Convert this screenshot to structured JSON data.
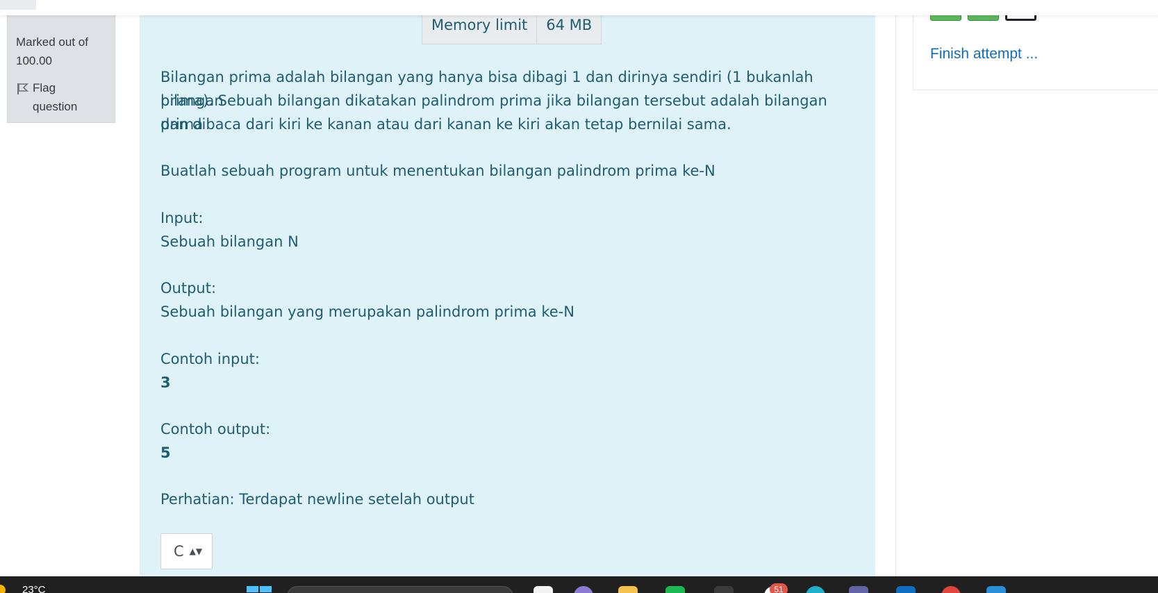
{
  "info": {
    "grade_label": "Marked out of",
    "grade_value": "100.00",
    "flag_label": "Flag",
    "flag_label_2": "question"
  },
  "limits": {
    "memory_label": "Memory limit",
    "memory_value": "64 MB"
  },
  "question": {
    "description_line1": "Bilangan prima adalah bilangan yang hanya bisa dibagi 1 dan dirinya sendiri (1 bukanlah bilangan",
    "description_line2": "prima). Sebuah bilangan dikatakan palindrom prima jika bilangan tersebut adalah bilangan prima",
    "description_line3": "dan dibaca dari kiri ke kanan atau dari kanan ke kiri akan tetap bernilai sama.",
    "task": "Buatlah sebuah program untuk menentukan bilangan palindrom prima ke-N",
    "input_label": "Input:",
    "input_desc": "Sebuah bilangan N",
    "output_label": "Output:",
    "output_desc": "Sebuah bilangan yang merupakan palindrom prima ke-N",
    "sample_input_label": "Contoh input:",
    "sample_input": "3",
    "sample_output_label": "Contoh output:",
    "sample_output": "5",
    "note": "Perhatian: Terdapat newline setelah output"
  },
  "language_select": {
    "value": "C"
  },
  "navigation": {
    "finish_label": "Finish attempt ...",
    "questions": [
      {
        "state": "answered"
      },
      {
        "state": "answered"
      },
      {
        "state": "unanswered"
      }
    ]
  },
  "taskbar": {
    "temperature": "23°C",
    "badge_count": "51"
  },
  "colors": {
    "qtext_bg": "#def2f8",
    "qtext_fg": "#1f5d70",
    "link": "#0f6cbf",
    "answered": "#5cb85c"
  }
}
